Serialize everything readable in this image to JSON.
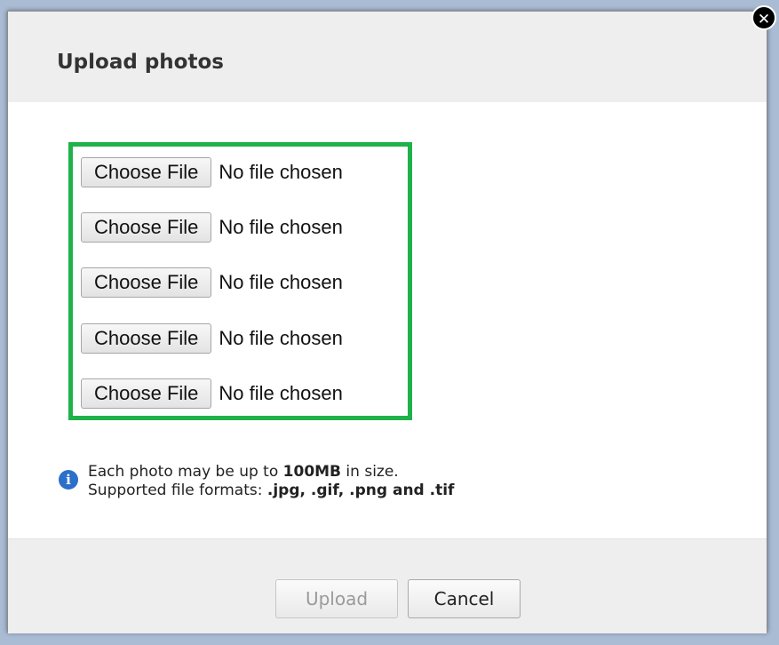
{
  "dialog": {
    "title": "Upload photos",
    "close_icon": "close-icon"
  },
  "file_inputs": [
    {
      "button_label": "Choose File",
      "status": "No file chosen"
    },
    {
      "button_label": "Choose File",
      "status": "No file chosen"
    },
    {
      "button_label": "Choose File",
      "status": "No file chosen"
    },
    {
      "button_label": "Choose File",
      "status": "No file chosen"
    },
    {
      "button_label": "Choose File",
      "status": "No file chosen"
    }
  ],
  "info": {
    "icon": "info-icon",
    "line1_prefix": "Each photo may be up to ",
    "line1_bold": "100MB",
    "line1_suffix": " in size.",
    "line2_prefix": "Supported file formats: ",
    "line2_bold": ".jpg, .gif, .png and .tif"
  },
  "footer": {
    "upload_label": "Upload",
    "cancel_label": "Cancel"
  },
  "colors": {
    "highlight_border": "#1fb24a",
    "info_icon": "#2b6fc8"
  }
}
